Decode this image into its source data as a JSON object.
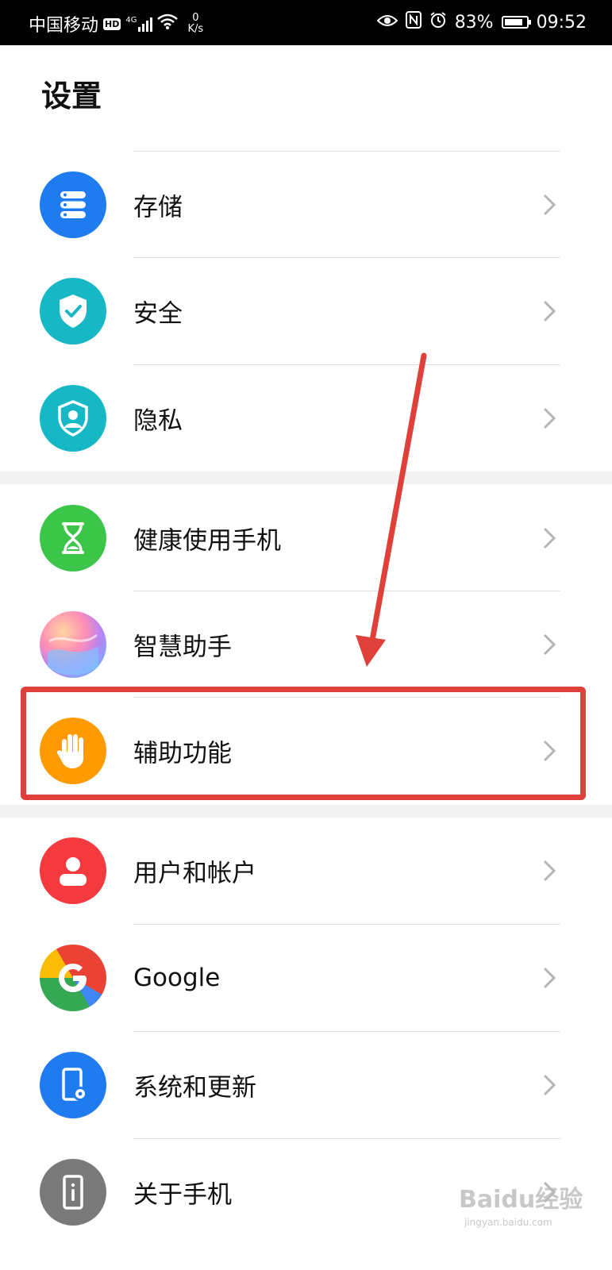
{
  "status_bar": {
    "carrier": "中国移动",
    "hd": "HD",
    "network": "4G",
    "speed_value": "0",
    "speed_unit": "K/s",
    "battery_percent": "83%",
    "battery_level": 0.83,
    "time": "09:52"
  },
  "page": {
    "title": "设置"
  },
  "items": [
    {
      "label": "存储",
      "icon": "storage-icon",
      "color": "#1e7cf0"
    },
    {
      "label": "安全",
      "icon": "security-shield-icon",
      "color": "#17b8c6"
    },
    {
      "label": "隐私",
      "icon": "privacy-icon",
      "color": "#17b8c6"
    },
    {
      "label": "健康使用手机",
      "icon": "hourglass-icon",
      "color": "#3bc64a"
    },
    {
      "label": "智慧助手",
      "icon": "smart-assistant-icon",
      "color": "#c08ef0"
    },
    {
      "label": "辅助功能",
      "icon": "hand-icon",
      "color": "#ff9a00"
    },
    {
      "label": "用户和帐户",
      "icon": "user-icon",
      "color": "#f43a3e"
    },
    {
      "label": "Google",
      "icon": "google-icon",
      "color": "#4285f4"
    },
    {
      "label": "系统和更新",
      "icon": "system-update-icon",
      "color": "#1e7cf0"
    },
    {
      "label": "关于手机",
      "icon": "about-phone-icon",
      "color": "#7a7a7a"
    }
  ],
  "annotation": {
    "color": "#e0403a"
  },
  "watermark": {
    "text": "Baidu经验",
    "sub": "jingyan.baidu.com"
  }
}
